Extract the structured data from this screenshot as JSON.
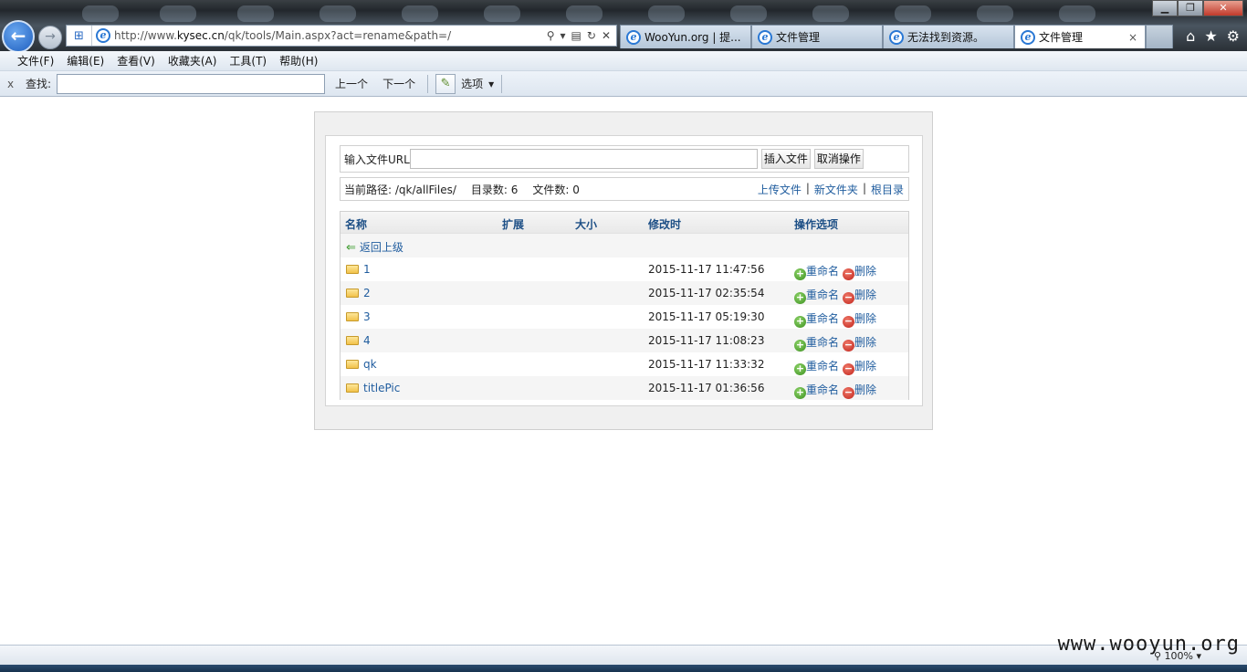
{
  "browser": {
    "address": {
      "prefix": "http://www.",
      "domain": "kysec.cn",
      "path": "/qk/tools/Main.aspx?act=rename&path=/"
    },
    "tabs": [
      {
        "title": "WooYun.org | 提..."
      },
      {
        "title": "文件管理"
      },
      {
        "title": "无法找到资源。"
      },
      {
        "title": "文件管理",
        "close": "×"
      }
    ],
    "menu": [
      "文件(F)",
      "编辑(E)",
      "查看(V)",
      "收藏夹(A)",
      "工具(T)",
      "帮助(H)"
    ],
    "find": {
      "close": "x",
      "label": "查找:",
      "value": "",
      "prev": "上一个",
      "next": "下一个",
      "options": "选项"
    },
    "zoom": "100%"
  },
  "page": {
    "url_label": "输入文件URL",
    "url_value": "",
    "insert_button": "插入文件",
    "cancel_button": "取消操作",
    "path_label": "当前路径: /qk/allFiles/",
    "dir_count": "目录数: 6",
    "file_count": "文件数: 0",
    "links": {
      "upload": "上传文件",
      "sep": "|",
      "newfolder": "新文件夹",
      "root": "根目录"
    },
    "columns": {
      "name": "名称",
      "ext": "扩展",
      "size": "大小",
      "mtime": "修改时",
      "actions": "操作选项"
    },
    "back_label": "返回上级",
    "rename_label": "重命名",
    "delete_label": "删除",
    "rows": [
      {
        "name": "1",
        "mtime": "2015-11-17 11:47:56"
      },
      {
        "name": "2",
        "mtime": "2015-11-17 02:35:54"
      },
      {
        "name": "3",
        "mtime": "2015-11-17 05:19:30"
      },
      {
        "name": "4",
        "mtime": "2015-11-17 11:08:23"
      },
      {
        "name": "qk",
        "mtime": "2015-11-17 11:33:32"
      },
      {
        "name": "titlePic",
        "mtime": "2015-11-17 01:36:56"
      }
    ]
  },
  "watermark": "www.wooyun.org"
}
